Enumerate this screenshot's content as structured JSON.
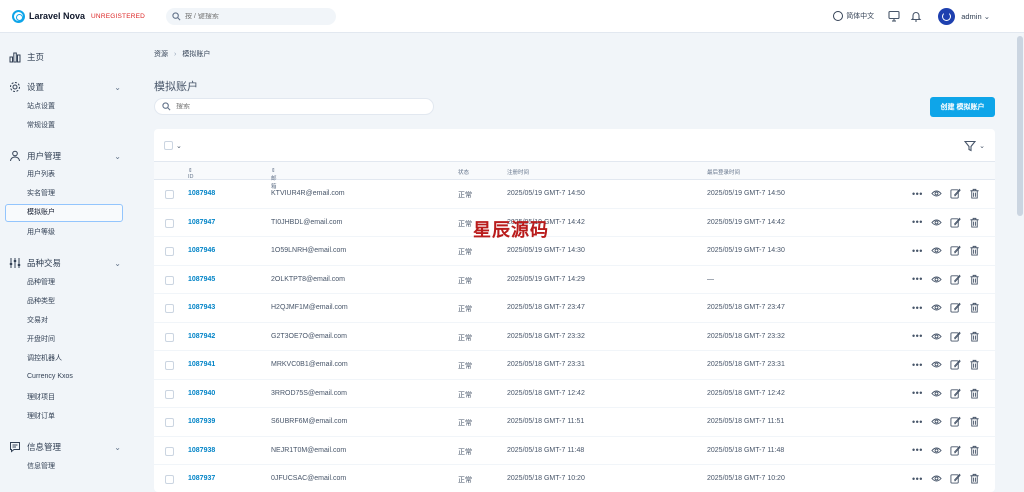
{
  "topbar": {
    "brand": "Laravel Nova",
    "unregistered": "UNREGISTERED",
    "search_placeholder": "按 / 键搜索",
    "language": "简体中文",
    "user": "admin"
  },
  "sidebar": {
    "home": "主页",
    "settings": {
      "label": "设置",
      "items": [
        "站点设置",
        "常规设置"
      ]
    },
    "users": {
      "label": "用户管理",
      "items": [
        "用户列表",
        "实名管理",
        "模拟账户",
        "用户等级"
      ]
    },
    "trading": {
      "label": "品种交易",
      "items": [
        "品种管理",
        "品种类型",
        "交易对",
        "开盘时间",
        "调控机器人",
        "Currency Kxos",
        "理财项目",
        "理财订单"
      ]
    },
    "messages": {
      "label": "信息管理",
      "items": [
        "信息管理"
      ]
    }
  },
  "breadcrumb": {
    "root": "资源",
    "current": "模拟账户"
  },
  "page": {
    "title": "模拟账户",
    "search_placeholder": "搜索",
    "create_button": "创建 模拟账户"
  },
  "table": {
    "headers": {
      "id": "ID",
      "email": "邮箱",
      "status": "状态",
      "registered": "注册时间",
      "last_login": "最后登录时间"
    },
    "rows": [
      {
        "id": "1087948",
        "email": "KTVIUR4R@email.com",
        "status": "正常",
        "registered": "2025/05/19 GMT-7 14:50",
        "last_login": "2025/05/19 GMT-7 14:50"
      },
      {
        "id": "1087947",
        "email": "TI0JHBDL@email.com",
        "status": "正常",
        "registered": "2025/05/19 GMT-7 14:42",
        "last_login": "2025/05/19 GMT-7 14:42"
      },
      {
        "id": "1087946",
        "email": "1O59LNRH@email.com",
        "status": "正常",
        "registered": "2025/05/19 GMT-7 14:30",
        "last_login": "2025/05/19 GMT-7 14:30"
      },
      {
        "id": "1087945",
        "email": "2OLKTPT8@email.com",
        "status": "正常",
        "registered": "2025/05/19 GMT-7 14:29",
        "last_login": "—"
      },
      {
        "id": "1087943",
        "email": "H2QJMF1M@email.com",
        "status": "正常",
        "registered": "2025/05/18 GMT-7 23:47",
        "last_login": "2025/05/18 GMT-7 23:47"
      },
      {
        "id": "1087942",
        "email": "G2T3OE7O@email.com",
        "status": "正常",
        "registered": "2025/05/18 GMT-7 23:32",
        "last_login": "2025/05/18 GMT-7 23:32"
      },
      {
        "id": "1087941",
        "email": "MRKVC0B1@email.com",
        "status": "正常",
        "registered": "2025/05/18 GMT-7 23:31",
        "last_login": "2025/05/18 GMT-7 23:31"
      },
      {
        "id": "1087940",
        "email": "3RROD75S@email.com",
        "status": "正常",
        "registered": "2025/05/18 GMT-7 12:42",
        "last_login": "2025/05/18 GMT-7 12:42"
      },
      {
        "id": "1087939",
        "email": "S6UBRF6M@email.com",
        "status": "正常",
        "registered": "2025/05/18 GMT-7 11:51",
        "last_login": "2025/05/18 GMT-7 11:51"
      },
      {
        "id": "1087938",
        "email": "NEJR1T0M@email.com",
        "status": "正常",
        "registered": "2025/05/18 GMT-7 11:48",
        "last_login": "2025/05/18 GMT-7 11:48"
      },
      {
        "id": "1087937",
        "email": "0JFUCSAC@email.com",
        "status": "正常",
        "registered": "2025/05/18 GMT-7 10:20",
        "last_login": "2025/05/18 GMT-7 10:20"
      }
    ]
  },
  "watermark": "星辰源码",
  "colors": {
    "accent": "#0ea5e9",
    "link": "#0284c7",
    "unregistered": "#dc2626"
  }
}
